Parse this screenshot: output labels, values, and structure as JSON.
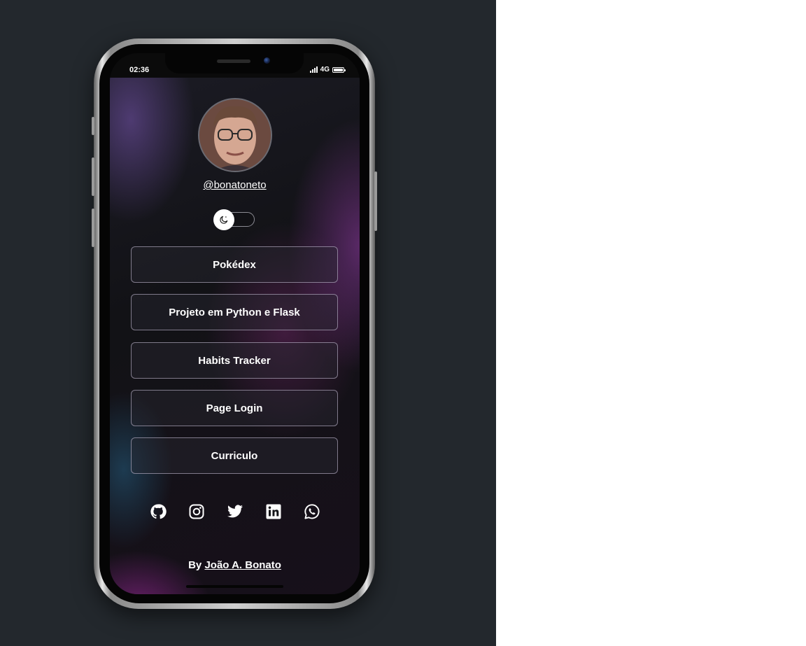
{
  "status_bar": {
    "time": "02:36",
    "network": "4G",
    "icons": [
      "signal-icon",
      "battery-icon"
    ]
  },
  "profile": {
    "username": "@bonatoneto",
    "avatar": "avatar-photo"
  },
  "theme_toggle": {
    "icon": "moon-icon",
    "state": "dark"
  },
  "links": [
    {
      "label": "Pokédex"
    },
    {
      "label": "Projeto em Python e Flask"
    },
    {
      "label": "Habits Tracker"
    },
    {
      "label": "Page Login"
    },
    {
      "label": "Curriculo"
    }
  ],
  "socials": [
    "github-icon",
    "instagram-icon",
    "twitter-icon",
    "linkedin-icon",
    "whatsapp-icon"
  ],
  "footer": {
    "prefix": "By",
    "author": "João A. Bonato"
  },
  "colors": {
    "page_background": "#23282d",
    "screen_background": "#0e0e12",
    "accent_purple": "#8a3c9c",
    "text": "#ffffff"
  }
}
